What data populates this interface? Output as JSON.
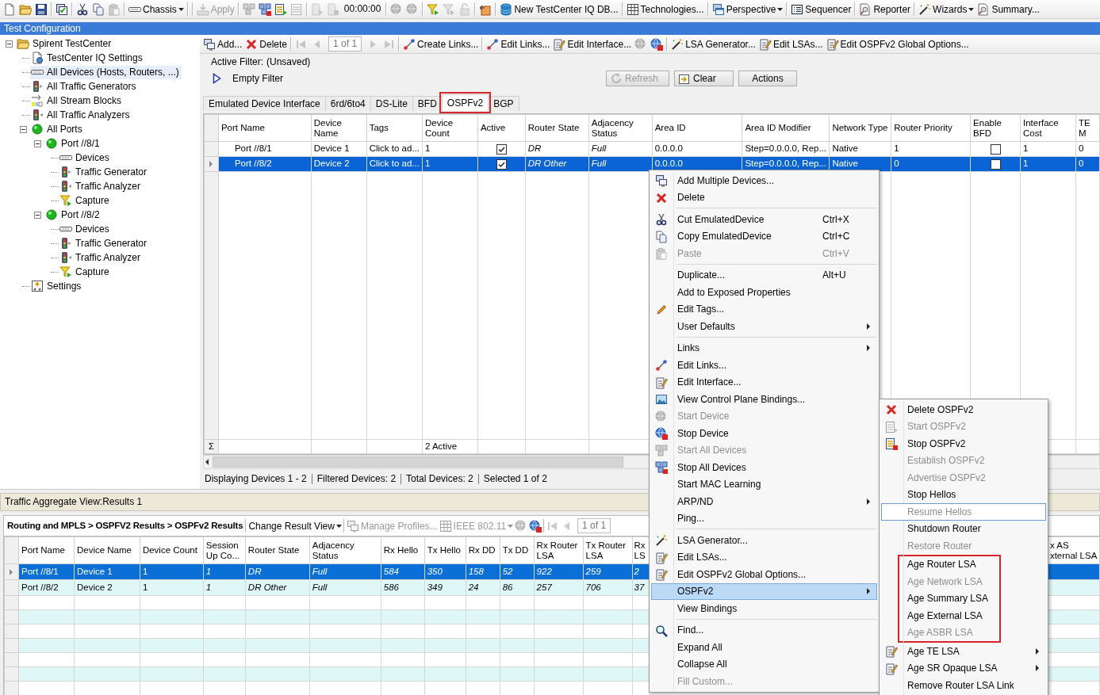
{
  "toolbar": [
    {
      "kind": "document",
      "disabled": false
    },
    {
      "kind": "folder",
      "disabled": false
    },
    {
      "kind": "disk",
      "disabled": false
    },
    {
      "kind": "separator"
    },
    {
      "kind": "windowcheck",
      "disabled": false
    },
    {
      "kind": "separator"
    },
    {
      "kind": "scissors",
      "disabled": false
    },
    {
      "kind": "copy",
      "disabled": false
    },
    {
      "kind": "clipboard",
      "disabled": true
    },
    {
      "kind": "separator"
    },
    {
      "kind": "keyboard",
      "label": "Chassis",
      "dropdown": true,
      "disabled": false
    },
    {
      "kind": "separator"
    },
    {
      "kind": "separator"
    },
    {
      "kind": "tray",
      "label": "Apply",
      "disabled": true
    },
    {
      "kind": "separator"
    },
    {
      "kind": "cubes",
      "disabled": true
    },
    {
      "kind": "cubesred",
      "disabled": false
    },
    {
      "kind": "frameplay",
      "disabled": false
    },
    {
      "kind": "frame",
      "disabled": true
    },
    {
      "kind": "separator"
    },
    {
      "kind": "pageplay",
      "disabled": true
    },
    {
      "kind": "pagestop",
      "disabled": true
    },
    {
      "kind": "text",
      "label": "00:00:00"
    },
    {
      "kind": "separator"
    },
    {
      "kind": "globe",
      "disabled": true
    },
    {
      "kind": "globe",
      "disabled": true
    },
    {
      "kind": "separator"
    },
    {
      "kind": "funnel",
      "disabled": false
    },
    {
      "kind": "funnel",
      "disabled": true
    },
    {
      "kind": "lock",
      "disabled": true
    },
    {
      "kind": "separator"
    },
    {
      "kind": "boxarrow",
      "disabled": false
    },
    {
      "kind": "separator"
    },
    {
      "kind": "database",
      "label": "New TestCenter IQ DB...",
      "disabled": false
    },
    {
      "kind": "separator"
    },
    {
      "kind": "grid",
      "label": "Technologies...",
      "disabled": false
    },
    {
      "kind": "separator"
    },
    {
      "kind": "windows",
      "label": "Perspective",
      "dropdown": true,
      "disabled": false
    },
    {
      "kind": "separator"
    },
    {
      "kind": "list",
      "label": "Sequencer",
      "disabled": false
    },
    {
      "kind": "separator"
    },
    {
      "kind": "reporter",
      "label": "Reporter",
      "disabled": false
    },
    {
      "kind": "separator"
    },
    {
      "kind": "wand",
      "label": "Wizards",
      "dropdown": true,
      "disabled": false
    },
    {
      "kind": "reporter",
      "label": "Summary...",
      "disabled": false
    }
  ],
  "panel_title": "Test Configuration",
  "tree": [
    {
      "label": "Spirent TestCenter",
      "kind": "folder",
      "expanded": true,
      "selected": false,
      "children": [
        {
          "label": "TestCenter IQ Settings",
          "kind": "settingspage",
          "selected": false
        },
        {
          "label": "All Devices (Hosts, Routers, ...)",
          "kind": "keyboard",
          "selected": true
        },
        {
          "label": "All Traffic Generators",
          "kind": "generator",
          "selected": false
        },
        {
          "label": "All Stream Blocks",
          "kind": "streams",
          "selected": false
        },
        {
          "label": "All Traffic Analyzers",
          "kind": "analyzer",
          "selected": false
        },
        {
          "label": "All Ports",
          "kind": "ball",
          "expanded": true,
          "selected": false,
          "children": [
            {
              "label": "Port //8/1",
              "kind": "ball",
              "expanded": true,
              "selected": false,
              "children": [
                {
                  "label": "Devices",
                  "kind": "keyboard",
                  "selected": false
                },
                {
                  "label": "Traffic Generator",
                  "kind": "generator",
                  "selected": false
                },
                {
                  "label": "Traffic Analyzer",
                  "kind": "analyzer",
                  "selected": false
                },
                {
                  "label": "Capture",
                  "kind": "funnel",
                  "selected": false
                }
              ]
            },
            {
              "label": "Port //8/2",
              "kind": "ball",
              "expanded": true,
              "selected": false,
              "children": [
                {
                  "label": "Devices",
                  "kind": "keyboard",
                  "selected": false
                },
                {
                  "label": "Traffic Generator",
                  "kind": "generator",
                  "selected": false
                },
                {
                  "label": "Traffic Analyzer",
                  "kind": "analyzer",
                  "selected": false
                },
                {
                  "label": "Capture",
                  "kind": "funnel",
                  "selected": false
                }
              ]
            }
          ]
        },
        {
          "label": "Settings",
          "kind": "controlpanel",
          "selected": false
        }
      ]
    }
  ],
  "device_toolbar": [
    {
      "kind": "monitors",
      "label": "Add...",
      "disabled": false
    },
    {
      "kind": "delete",
      "label": "Delete",
      "disabled": false
    },
    {
      "kind": "separator"
    },
    {
      "kind": "first",
      "disabled": true
    },
    {
      "kind": "prev",
      "disabled": true
    },
    {
      "kind": "page",
      "label": "1 of 1"
    },
    {
      "kind": "next",
      "disabled": true
    },
    {
      "kind": "last",
      "disabled": true
    },
    {
      "kind": "separator"
    },
    {
      "kind": "link",
      "label": "Create Links...",
      "disabled": false
    },
    {
      "kind": "separator"
    },
    {
      "kind": "link",
      "label": "Edit Links...",
      "disabled": false
    },
    {
      "kind": "editform",
      "label": "Edit Interface...",
      "disabled": false
    },
    {
      "kind": "globe",
      "disabled": true
    },
    {
      "kind": "globestop",
      "disabled": false
    },
    {
      "kind": "separator"
    },
    {
      "kind": "wand",
      "label": "LSA Generator...",
      "disabled": false
    },
    {
      "kind": "editform",
      "label": "Edit LSAs...",
      "disabled": false
    },
    {
      "kind": "editform",
      "label": "Edit OSPFv2 Global Options...",
      "disabled": false
    }
  ],
  "filter": {
    "label": "Active Filter:",
    "status": "(Unsaved)",
    "name": "Empty Filter",
    "buttons": [
      {
        "kind": "refresh",
        "label": "Refresh",
        "disabled": true
      },
      {
        "kind": "clear",
        "label": "Clear",
        "disabled": false
      },
      {
        "kind": "plain",
        "label": "Actions",
        "disabled": false
      }
    ]
  },
  "tabs": [
    {
      "label": "Emulated Device Interface",
      "selected": false,
      "annotated": false
    },
    {
      "label": "6rd/6to4",
      "selected": false,
      "annotated": false
    },
    {
      "label": "DS-Lite",
      "selected": false,
      "annotated": false
    },
    {
      "label": "BFD",
      "selected": false,
      "annotated": false
    },
    {
      "label": "OSPFv2",
      "selected": true,
      "annotated": true
    },
    {
      "label": "BGP",
      "selected": false,
      "annotated": false
    }
  ],
  "device_grid": {
    "columns": [
      {
        "label": "Port Name",
        "kind": "text"
      },
      {
        "label": "Device Name",
        "kind": "text"
      },
      {
        "label": "Tags",
        "kind": "text"
      },
      {
        "label": "Device Count",
        "kind": "text"
      },
      {
        "label": "Active",
        "kind": "check"
      },
      {
        "label": "Router State",
        "kind": "readonly"
      },
      {
        "label": "Adjacency Status",
        "kind": "readonly"
      },
      {
        "label": "Area ID",
        "kind": "text"
      },
      {
        "label": "Area ID Modifier",
        "kind": "text"
      },
      {
        "label": "Network Type",
        "kind": "text"
      },
      {
        "label": "Router Priority",
        "kind": "text"
      },
      {
        "label": "Enable BFD",
        "kind": "check"
      },
      {
        "label": "Interface Cost",
        "kind": "text"
      },
      {
        "label": "TE M",
        "kind": "text"
      }
    ],
    "rows": [
      {
        "selected": false,
        "cells": [
          "Port //8/1",
          "Device 1",
          "Click to ad...",
          "1",
          true,
          "DR",
          "Full",
          "0.0.0.0",
          "Step=0.0.0.0, Rep...",
          "Native",
          "1",
          false,
          "1",
          "0"
        ]
      },
      {
        "selected": true,
        "cells": [
          "Port //8/2",
          "Device 2",
          "Click to ad...",
          "1",
          true,
          "DR Other",
          "Full",
          "0.0.0.0",
          "Step=0.0.0.0, Rep...",
          "Native",
          "0",
          false,
          "1",
          "0"
        ]
      }
    ],
    "summary_symbol": "Σ",
    "summary_device_count": "2 Active"
  },
  "device_status": [
    "Displaying Devices 1 - 2",
    "Filtered Devices: 2",
    "Total Devices: 2",
    "Selected 1 of 2"
  ],
  "results": {
    "title": "Traffic Aggregate View:Results 1",
    "breadcrumb": "Routing and MPLS > OSPFV2 Results > OSPFv2 Results",
    "toolbar": [
      {
        "kind": "separator"
      },
      {
        "kind": "plain",
        "label": "Change Result View",
        "dropdown": true,
        "disabled": false
      },
      {
        "kind": "separator"
      },
      {
        "kind": "monitors",
        "label": "Manage Profiles...",
        "disabled": true
      },
      {
        "kind": "grid",
        "label": "IEEE 802.11",
        "dropdown": true,
        "disabled": true
      },
      {
        "kind": "globe",
        "disabled": true
      },
      {
        "kind": "globestop",
        "disabled": false
      },
      {
        "kind": "separator"
      },
      {
        "kind": "first",
        "disabled": true
      },
      {
        "kind": "prev",
        "disabled": true
      },
      {
        "kind": "page",
        "label": "1 of 1"
      }
    ],
    "columns": [
      {
        "label": "Port Name",
        "kind": "text"
      },
      {
        "label": "Device Name",
        "kind": "text"
      },
      {
        "label": "Device Count",
        "kind": "text"
      },
      {
        "label": "Session Up Co...",
        "kind": "readonly"
      },
      {
        "label": "Router State",
        "kind": "readonly"
      },
      {
        "label": "Adjacency Status",
        "kind": "readonly"
      },
      {
        "label": "Rx Hello",
        "kind": "readonly"
      },
      {
        "label": "Tx Hello",
        "kind": "readonly"
      },
      {
        "label": "Rx DD",
        "kind": "readonly"
      },
      {
        "label": "Tx DD",
        "kind": "readonly"
      },
      {
        "label": "Rx Router LSA",
        "kind": "readonly"
      },
      {
        "label": "Tx Router LSA",
        "kind": "readonly"
      },
      {
        "label": "Rx LS",
        "kind": "readonly"
      },
      {
        "label": "x AS xternal LSA",
        "kind": "readonly"
      }
    ],
    "rows": [
      {
        "selected": true,
        "cells": [
          "Port //8/1",
          "Device 1",
          "1",
          "1",
          "DR",
          "Full",
          "584",
          "350",
          "158",
          "52",
          "922",
          "259",
          "2"
        ]
      },
      {
        "selected": false,
        "cells": [
          "Port //8/2",
          "Device 2",
          "1",
          "1",
          "DR Other",
          "Full",
          "586",
          "349",
          "24",
          "86",
          "257",
          "706",
          "37"
        ]
      }
    ]
  },
  "context_menu": [
    [
      {
        "label": "Add Multiple Devices...",
        "kind": "monitors",
        "disabled": false,
        "highlighted": false,
        "submenu": false
      },
      {
        "label": "Delete",
        "kind": "delete",
        "disabled": false,
        "highlighted": false,
        "submenu": false
      }
    ],
    [
      {
        "label": "Cut EmulatedDevice",
        "shortcut": "Ctrl+X",
        "kind": "scissors",
        "disabled": false,
        "highlighted": false,
        "submenu": false
      },
      {
        "label": "Copy EmulatedDevice",
        "shortcut": "Ctrl+C",
        "kind": "copy",
        "disabled": false,
        "highlighted": false,
        "submenu": false
      },
      {
        "label": "Paste",
        "shortcut": "Ctrl+V",
        "kind": "clipboard",
        "disabled": true,
        "highlighted": false,
        "submenu": false
      }
    ],
    [
      {
        "label": "Duplicate...",
        "shortcut": "Alt+U",
        "kind": "plain",
        "disabled": false,
        "highlighted": false,
        "submenu": false
      },
      {
        "label": "Add to Exposed Properties",
        "kind": "plain",
        "disabled": false,
        "highlighted": false,
        "submenu": false
      },
      {
        "label": "Edit Tags...",
        "kind": "pencil",
        "disabled": false,
        "highlighted": false,
        "submenu": false
      },
      {
        "label": "User Defaults",
        "kind": "plain",
        "disabled": false,
        "highlighted": false,
        "submenu": true
      }
    ],
    [
      {
        "label": "Links",
        "kind": "plain",
        "disabled": false,
        "highlighted": false,
        "submenu": true
      },
      {
        "label": "Edit Links...",
        "kind": "link",
        "disabled": false,
        "highlighted": false,
        "submenu": false
      },
      {
        "label": "Edit Interface...",
        "kind": "editform",
        "disabled": false,
        "highlighted": false,
        "submenu": false
      },
      {
        "label": "View Control Plane Bindings...",
        "kind": "image",
        "disabled": false,
        "highlighted": false,
        "submenu": false
      },
      {
        "label": "Start Device",
        "kind": "globe",
        "disabled": true,
        "highlighted": false,
        "submenu": false
      },
      {
        "label": "Stop Device",
        "kind": "globestop",
        "disabled": false,
        "highlighted": false,
        "submenu": false
      },
      {
        "label": "Start All Devices",
        "kind": "cubes",
        "disabled": true,
        "highlighted": false,
        "submenu": false
      },
      {
        "label": "Stop All Devices",
        "kind": "cubesred",
        "disabled": false,
        "highlighted": false,
        "submenu": false
      },
      {
        "label": "Start MAC Learning",
        "kind": "plain",
        "disabled": false,
        "highlighted": false,
        "submenu": false
      },
      {
        "label": "ARP/ND",
        "kind": "plain",
        "disabled": false,
        "highlighted": false,
        "submenu": true
      },
      {
        "label": "Ping...",
        "kind": "plain",
        "disabled": false,
        "highlighted": false,
        "submenu": false
      }
    ],
    [
      {
        "label": "LSA Generator...",
        "kind": "wand",
        "disabled": false,
        "highlighted": false,
        "submenu": false
      },
      {
        "label": "Edit LSAs...",
        "kind": "editform",
        "disabled": false,
        "highlighted": false,
        "submenu": false
      },
      {
        "label": "Edit OSPFv2 Global Options...",
        "kind": "editform",
        "disabled": false,
        "highlighted": false,
        "submenu": false
      },
      {
        "label": "OSPFv2",
        "kind": "plain",
        "disabled": false,
        "highlighted": true,
        "submenu": true
      },
      {
        "label": "View Bindings",
        "kind": "plain",
        "disabled": false,
        "highlighted": false,
        "submenu": false
      }
    ],
    [
      {
        "label": "Find...",
        "kind": "search",
        "disabled": false,
        "highlighted": false,
        "submenu": false
      },
      {
        "label": "Expand All",
        "kind": "plain",
        "disabled": false,
        "highlighted": false,
        "submenu": false
      },
      {
        "label": "Collapse All",
        "kind": "plain",
        "disabled": false,
        "highlighted": false,
        "submenu": false
      },
      {
        "label": "Fill Custom...",
        "kind": "plain",
        "disabled": true,
        "highlighted": false,
        "submenu": false
      }
    ]
  ],
  "submenu": [
    {
      "label": "Delete OSPFv2",
      "kind": "delete",
      "disabled": false,
      "highlighted": false,
      "submenu": false,
      "annotated": false
    },
    {
      "label": "Start OSPFv2",
      "kind": "frameplay",
      "disabled": true,
      "highlighted": false,
      "submenu": false,
      "annotated": false
    },
    {
      "label": "Stop OSPFv2",
      "kind": "framestop",
      "disabled": false,
      "highlighted": false,
      "submenu": false,
      "annotated": false
    },
    {
      "label": "Establish OSPFv2",
      "kind": "plain",
      "disabled": true,
      "highlighted": false,
      "submenu": false,
      "annotated": false
    },
    {
      "label": "Advertise OSPFv2",
      "kind": "plain",
      "disabled": true,
      "highlighted": false,
      "submenu": false,
      "annotated": false
    },
    {
      "label": "Stop Hellos",
      "kind": "plain",
      "disabled": false,
      "highlighted": false,
      "submenu": false,
      "annotated": false
    },
    {
      "label": "Resume Hellos",
      "kind": "plain",
      "disabled": true,
      "highlighted": true,
      "submenu": false,
      "annotated": false
    },
    {
      "label": "Shutdown Router",
      "kind": "plain",
      "disabled": false,
      "highlighted": false,
      "submenu": false,
      "annotated": false
    },
    {
      "label": "Restore Router",
      "kind": "plain",
      "disabled": true,
      "highlighted": false,
      "submenu": false,
      "annotated": false
    },
    {
      "label": "Age Router LSA",
      "kind": "plain",
      "disabled": false,
      "highlighted": false,
      "submenu": false,
      "annotated": true
    },
    {
      "label": "Age Network LSA",
      "kind": "plain",
      "disabled": true,
      "highlighted": false,
      "submenu": false,
      "annotated": true
    },
    {
      "label": "Age Summary LSA",
      "kind": "plain",
      "disabled": false,
      "highlighted": false,
      "submenu": false,
      "annotated": true
    },
    {
      "label": "Age External LSA",
      "kind": "plain",
      "disabled": false,
      "highlighted": false,
      "submenu": false,
      "annotated": true
    },
    {
      "label": "Age ASBR LSA",
      "kind": "plain",
      "disabled": true,
      "highlighted": false,
      "submenu": false,
      "annotated": true
    },
    {
      "label": "Age TE LSA",
      "kind": "editform",
      "disabled": false,
      "highlighted": false,
      "submenu": true,
      "annotated": false
    },
    {
      "label": "Age SR Opaque LSA",
      "kind": "editform",
      "disabled": false,
      "highlighted": false,
      "submenu": true,
      "annotated": false
    },
    {
      "label": "Remove Router LSA Link",
      "kind": "plain",
      "disabled": false,
      "highlighted": false,
      "submenu": false,
      "annotated": false
    }
  ]
}
